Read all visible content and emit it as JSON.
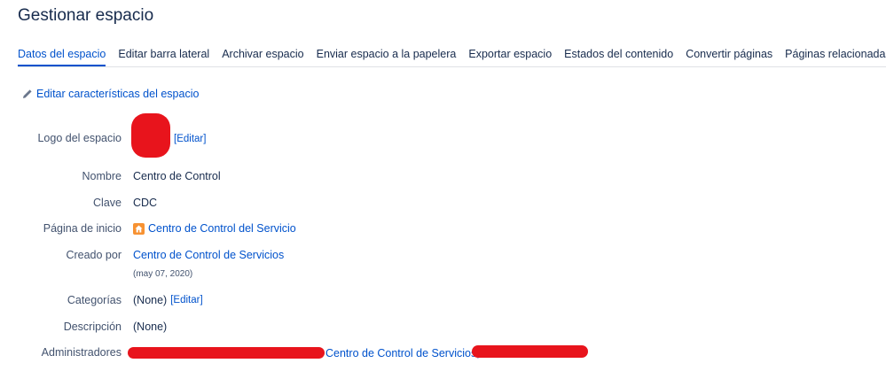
{
  "page": {
    "title": "Gestionar espacio"
  },
  "tabs": [
    {
      "label": "Datos del espacio",
      "active": true
    },
    {
      "label": "Editar barra lateral"
    },
    {
      "label": "Archivar espacio"
    },
    {
      "label": "Enviar espacio a la papelera"
    },
    {
      "label": "Exportar espacio"
    },
    {
      "label": "Estados del contenido"
    },
    {
      "label": "Convertir páginas"
    },
    {
      "label": "Páginas relacionadas"
    }
  ],
  "edit_properties": {
    "label": "Editar características del espacio",
    "icon": "pencil-icon"
  },
  "details": {
    "logo": {
      "label": "Logo del espacio",
      "edit": "[Editar]"
    },
    "name": {
      "label": "Nombre",
      "value": "Centro de Control"
    },
    "key": {
      "label": "Clave",
      "value": "CDC"
    },
    "home": {
      "label": "Página de inicio",
      "value": "Centro de Control del Servicio",
      "icon": "home-icon"
    },
    "created": {
      "label": "Creado por",
      "value": "Centro de Control de Servicios",
      "date": "(may 07, 2020)"
    },
    "categories": {
      "label": "Categorías",
      "value": "(None)",
      "edit": "[Editar]"
    },
    "description": {
      "label": "Descripción",
      "value": "(None)"
    },
    "admins": {
      "label": "Administradores",
      "value": "Centro de Control de Servicios,"
    }
  },
  "colors": {
    "link": "#0052cc",
    "text": "#172b4d",
    "redaction": "#e8141c",
    "home_icon": "#f79232"
  }
}
